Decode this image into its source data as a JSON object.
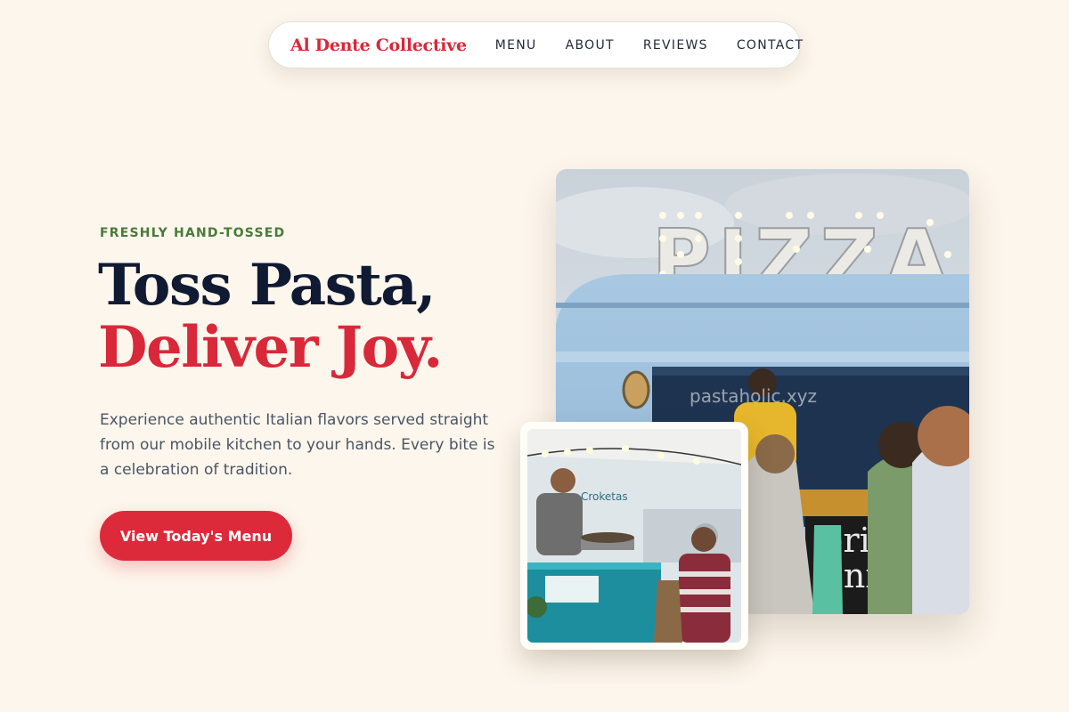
{
  "nav": {
    "brand": "Al Dente Collective",
    "links": [
      "MENU",
      "ABOUT",
      "REVIEWS",
      "CONTACT"
    ]
  },
  "hero": {
    "eyebrow": "FRESHLY HAND-TOSSED",
    "headline_line1": "Toss Pasta,",
    "headline_line2": "Deliver Joy.",
    "lede": "Experience authentic Italian flavors served straight from our mobile kitchen to your hands. Every bite is a celebration of tradition.",
    "cta_label": "View Today's Menu"
  },
  "photos": {
    "main_sign": "PIZZA",
    "main_watermark": "pastaholic.xyz",
    "main_board_text": "erit\noni\ne -",
    "inset_sign": "Croketas"
  },
  "colors": {
    "background": "#fdf6ec",
    "accent_red": "#d8283a",
    "navy": "#101a33",
    "eyebrow_green": "#4a7a3a",
    "truck_blue": "#9cc0dc",
    "teal_cart": "#1f8fa0"
  }
}
